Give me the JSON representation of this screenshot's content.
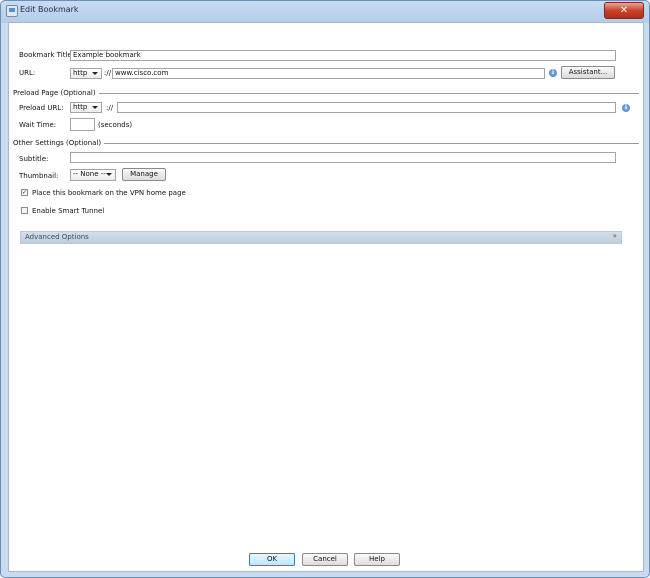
{
  "window": {
    "title": "Edit Bookmark",
    "close_glyph": "✕"
  },
  "bookmark": {
    "title_label": "Bookmark Title:",
    "title_value": "Example bookmark",
    "url_label": "URL:",
    "protocol": "http",
    "separator": "://",
    "url_value": "www.cisco.com",
    "assistant_button": "Assistant..."
  },
  "preload": {
    "section_title": "Preload Page (Optional)",
    "url_label": "Preload URL:",
    "protocol": "http",
    "separator": "://",
    "url_value": "",
    "wait_label": "Wait Time:",
    "wait_value": "",
    "wait_unit": "(seconds)"
  },
  "other": {
    "section_title": "Other Settings (Optional)",
    "subtitle_label": "Subtitle:",
    "subtitle_value": "",
    "thumbnail_label": "Thumbnail:",
    "thumbnail_value": "-- None --",
    "manage_button": "Manage",
    "place_on_home_label": "Place this bookmark on the VPN home page",
    "place_on_home_checked": true,
    "smart_tunnel_label": "Enable Smart Tunnel",
    "smart_tunnel_checked": false
  },
  "advanced": {
    "label": "Advanced Options",
    "chevron": "»"
  },
  "footer": {
    "ok": "OK",
    "cancel": "Cancel",
    "help": "Help"
  },
  "icons": {
    "info": "i",
    "check": "✓"
  }
}
